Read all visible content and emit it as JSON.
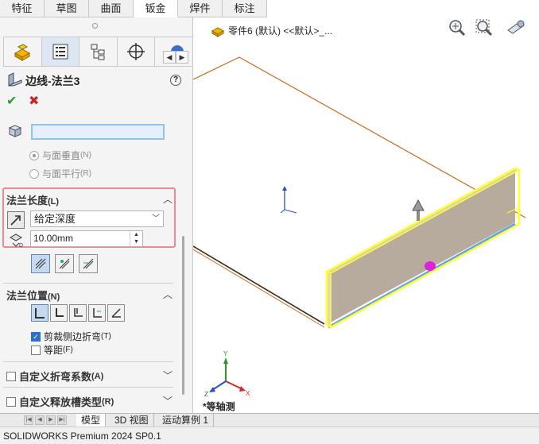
{
  "command_tabs": [
    {
      "label": "特征",
      "active": false
    },
    {
      "label": "草图",
      "active": false
    },
    {
      "label": "曲面",
      "active": false
    },
    {
      "label": "钣金",
      "active": true
    },
    {
      "label": "焊件",
      "active": false
    },
    {
      "label": "标注",
      "active": false
    }
  ],
  "manager_tabs": [
    "feature-manager",
    "property-manager",
    "configuration-manager",
    "dimxpert-manager",
    "display-manager"
  ],
  "property_manager": {
    "title": "边线-法兰3",
    "help": "?",
    "ok": "✔",
    "cancel": "✖",
    "angle_section": {
      "radio_perpendicular": "与面垂直",
      "radio_perpendicular_key": "(N)",
      "radio_parallel": "与面平行",
      "radio_parallel_key": "(R)"
    },
    "flange_length": {
      "title": "法兰长度",
      "title_key": "(L)",
      "end_condition": "给定深度",
      "length_value": "10.00mm"
    },
    "flange_position": {
      "title": "法兰位置",
      "title_key": "(N)",
      "trim_side_bends": "剪裁侧边折弯",
      "trim_side_bends_key": "(T)",
      "trim_checked": true,
      "offset": "等距",
      "offset_key": "(F)",
      "offset_checked": false
    },
    "custom_bend_allowance": "自定义折弯系数",
    "custom_bend_allowance_key": "(A)",
    "custom_relief_type": "自定义释放槽类型",
    "custom_relief_type_key": "(R)"
  },
  "viewport": {
    "part_label": "零件6 (默认) <<默认>_...",
    "view_orientation": "*等轴测",
    "accent_yellow": "#ffff33",
    "accent_magenta": "#e020e0",
    "edge_color": "#c8691f"
  },
  "bottom_tabs": [
    "模型",
    "3D 视图",
    "运动算例 1"
  ],
  "status": "SOLIDWORKS Premium 2024 SP0.1"
}
